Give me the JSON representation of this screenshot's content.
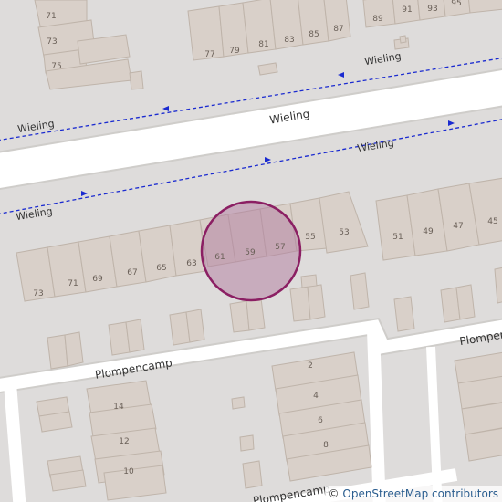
{
  "map": {
    "colors": {
      "background": "#dedcdb",
      "road": "#ffffff",
      "road_edge": "#cfcdca",
      "building": "#d9d0c9",
      "building_edge": "#bfb4aa",
      "footway": "#1b2bd0",
      "marker_fill": "#b27ba0",
      "marker_stroke": "#8b1f63"
    },
    "streets": {
      "wieling_main": "Wieling",
      "wieling_top_path": "Wieling",
      "wieling_left_upper": "Wieling",
      "wieling_mid_path": "Wieling",
      "wieling_left_lower": "Wieling",
      "plompencamp_left": "Plompencamp",
      "plompencamp_right": "Plompen",
      "plompencamp_bottom": "Plompencamp"
    },
    "house_numbers": {
      "n71": "71",
      "n73": "73",
      "n75": "75",
      "n77": "77",
      "n79": "79",
      "n81": "81",
      "n83": "83",
      "n85": "85",
      "n87": "87",
      "n89": "89",
      "n91": "91",
      "n93": "93",
      "n95": "95",
      "s73": "73",
      "s71": "71",
      "s69": "69",
      "s67": "67",
      "s65": "65",
      "s63": "63",
      "s61": "61",
      "s59": "59",
      "s57": "57",
      "s55": "55",
      "s53": "53",
      "s51": "51",
      "s49": "49",
      "s47": "47",
      "s45": "45",
      "p14": "14",
      "p12": "12",
      "p10": "10",
      "p2": "2",
      "p4": "4",
      "p6": "6",
      "p8": "8"
    },
    "marker": {
      "type": "highlight-circle",
      "house_number": "59"
    },
    "attribution": {
      "copyright": "©",
      "link_text": "OpenStreetMap contributors"
    }
  }
}
